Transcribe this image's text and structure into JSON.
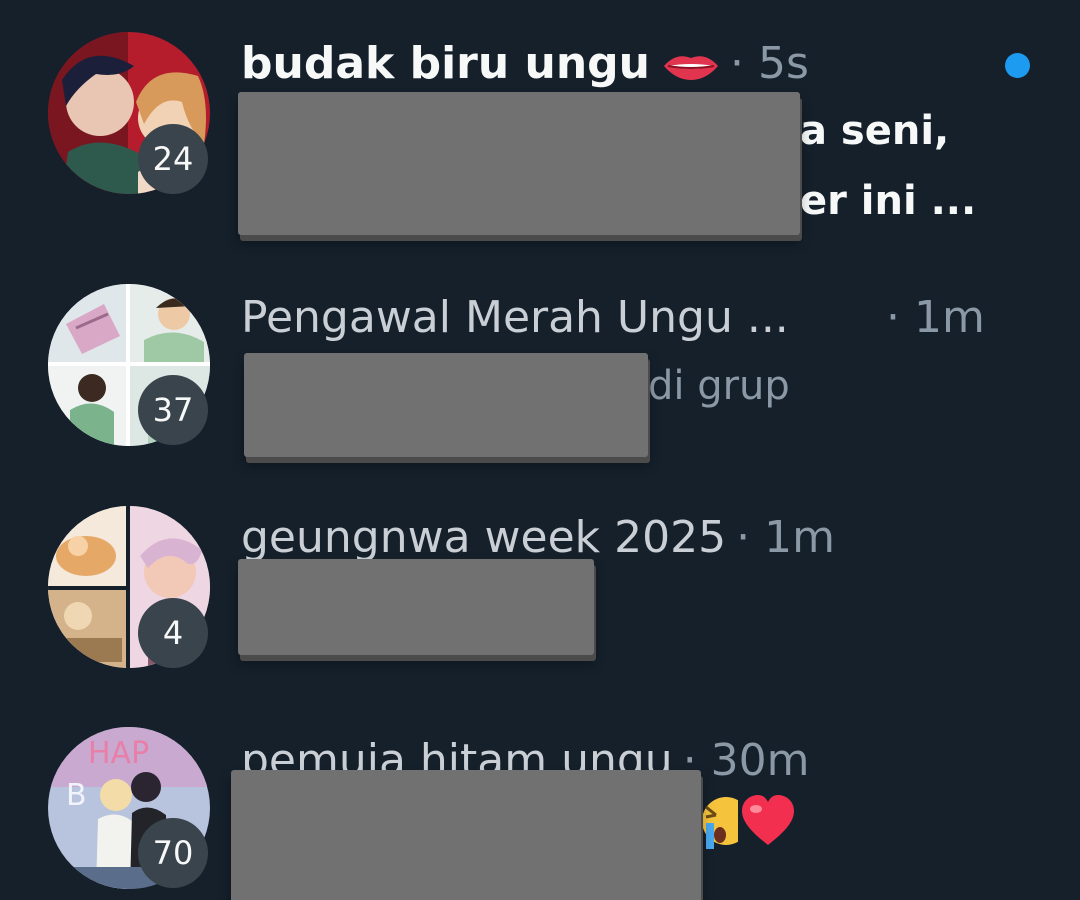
{
  "conversations": [
    {
      "name": "budak biru ungu",
      "name_emoji_icon": "lips-emoji-icon",
      "time": "· 5s",
      "unread_count": "24",
      "unread": true,
      "preview_lines": [
        "a seni,",
        "er ini ..."
      ]
    },
    {
      "name": "Pengawal Merah Ungu ...",
      "time": "· 1m",
      "unread_count": "37",
      "unread": false,
      "preview_lines": [
        "di grup"
      ]
    },
    {
      "name": "geungnwa week 2025",
      "time": "· 1m",
      "unread_count": "4",
      "unread": false,
      "preview_lines": []
    },
    {
      "name": "pemuja hitam ungu",
      "time": "· 30m",
      "unread_count": "70",
      "unread": false,
      "preview_emoji_icons": [
        "loudly-crying-face-emoji-icon",
        "red-heart-emoji-icon"
      ]
    }
  ],
  "colors": {
    "background": "#15202b",
    "unread_dot": "#1d9bf0",
    "meta_text": "#8b98a5",
    "redaction": "#717171"
  }
}
